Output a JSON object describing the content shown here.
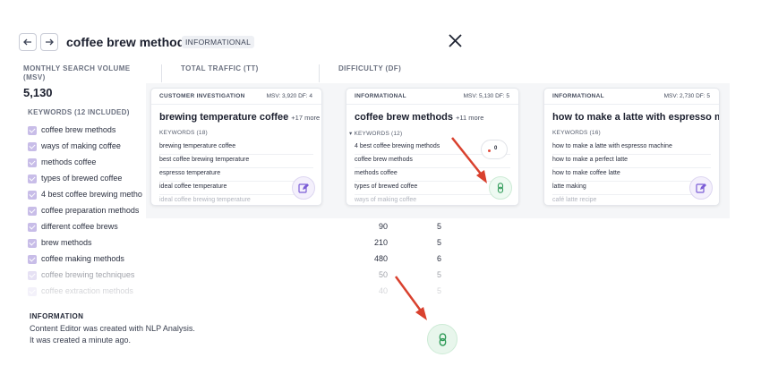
{
  "header": {
    "title": "coffee brew methods",
    "intent_badge": "INFORMATIONAL"
  },
  "metrics": {
    "msv_label": "MONTHLY SEARCH VOLUME",
    "msv_label_abbr": "(MSV)",
    "msv_value": "5,130",
    "traffic_label": "TOTAL TRAFFIC (TT)",
    "difficulty_label": "DIFFICULTY (DF)"
  },
  "keywords": {
    "header": "KEYWORDS (12 INCLUDED)",
    "rows": [
      {
        "kw": "coffee brew methods",
        "vol": "",
        "dif": ""
      },
      {
        "kw": "ways of making coffee",
        "vol": "",
        "dif": ""
      },
      {
        "kw": "methods coffee",
        "vol": "",
        "dif": ""
      },
      {
        "kw": "types of brewed coffee",
        "vol": "",
        "dif": ""
      },
      {
        "kw": "4 best coffee brewing metho",
        "vol": "",
        "dif": ""
      },
      {
        "kw": "coffee preparation methods",
        "vol": "",
        "dif": ""
      },
      {
        "kw": "different coffee brews",
        "vol": "90",
        "dif": "5"
      },
      {
        "kw": "brew methods",
        "vol": "210",
        "dif": "5"
      },
      {
        "kw": "coffee making methods",
        "vol": "480",
        "dif": "6"
      },
      {
        "kw": "coffee brewing techniques",
        "vol": "50",
        "dif": "5"
      },
      {
        "kw": "coffee extraction methods",
        "vol": "40",
        "dif": "5"
      }
    ]
  },
  "information": {
    "title": "INFORMATION",
    "line1": "Content Editor was created with NLP Analysis.",
    "line2": "It was created a minute ago."
  },
  "cards": [
    {
      "intent": "CUSTOMER INVESTIGATION",
      "stats": "MSV: 3,920  DF: 4",
      "title": "brewing temperature coffee",
      "more": "+17 more",
      "kw_label": "KEYWORDS (18)",
      "kws": [
        "brewing temperature coffee",
        "best coffee brewing temperature",
        "espresso temperature",
        "ideal coffee temperature",
        "ideal coffee brewing temperature"
      ]
    },
    {
      "intent": "INFORMATIONAL",
      "stats": "MSV: 5,130  DF: 5",
      "title": "coffee brew methods",
      "more": "+11 more",
      "kw_label": "▾ KEYWORDS (12)",
      "kws": [
        "4 best coffee brewing methods",
        "coffee brew methods",
        "methods coffee",
        "types of brewed coffee",
        "ways of making coffee"
      ]
    },
    {
      "intent": "INFORMATIONAL",
      "stats": "MSV: 2,730  DF: 5",
      "title": "how to make a latte with espresso m…",
      "more": "",
      "kw_label": "KEYWORDS (16)",
      "kws": [
        "how to make a latte with espresso machine",
        "how to make a perfect latte",
        "how to make coffee latte",
        "latte making",
        "café latte recipe"
      ]
    }
  ],
  "mini_gauge": {
    "value": "0"
  },
  "colors": {
    "accent_purple": "#7b5cd6",
    "checkbox": "#c8bde8",
    "link_green": "#2e9a57",
    "arrow_red": "#d9412e"
  }
}
